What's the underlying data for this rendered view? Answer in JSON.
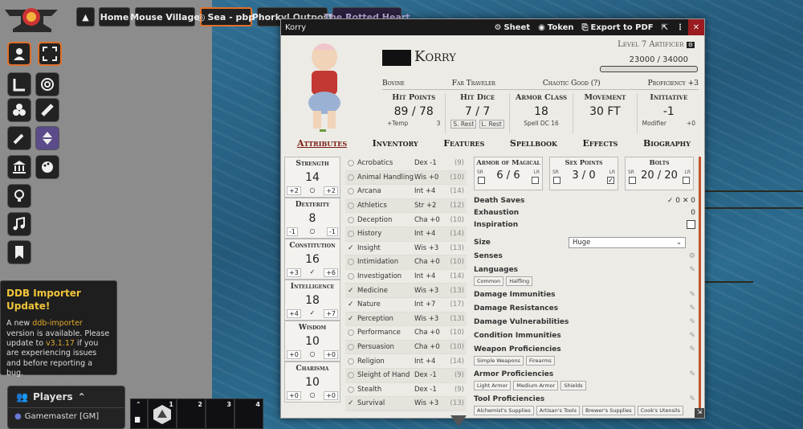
{
  "nav": {
    "home": "Home",
    "mouse_village": "Mouse Village",
    "sea": "Sea - pbp",
    "phorkyl": "Phorkyl Outpost",
    "rotted": "The Rotted Heart"
  },
  "ddb": {
    "title": "DDB Importer Update!",
    "line1": "A new ",
    "link": "ddb-importer",
    "line2": " version is available. Please update to ",
    "version": "v3.1.17",
    "line3": " if you are experiencing issues and before reporting a bug.",
    "close": "Click to close"
  },
  "players": {
    "title": "Players",
    "gm": "Gamemaster [GM]"
  },
  "hotbar": [
    "1",
    "2",
    "3",
    "4"
  ],
  "sheet": {
    "title": "Korry",
    "buttons": {
      "sheet": "Sheet",
      "token": "Token",
      "export": "Export to PDF"
    },
    "name": "Korry",
    "level": "Level 7 Artificer",
    "xp": "23000 / 34000",
    "info": [
      "Bovine",
      "Far Traveler",
      "Chaotic Good (?)",
      "Proficiency +3"
    ],
    "stats": [
      {
        "label": "Hit Points",
        "value": "89 / 78",
        "sub1": "+Temp",
        "sub2": "3"
      },
      {
        "label": "Hit Dice",
        "value": "7 / 7",
        "sub1": "S. Rest",
        "sub2": "L. Rest"
      },
      {
        "label": "Armor Class",
        "value": "18",
        "sub1": "Spell DC 16",
        "sub2": ""
      },
      {
        "label": "Movement",
        "value": "30 FT",
        "sub1": "",
        "sub2": ""
      },
      {
        "label": "Initiative",
        "value": "-1",
        "sub1": "Modifier",
        "sub2": "+0"
      }
    ],
    "tabs": [
      "Attributes",
      "Inventory",
      "Features",
      "Spellbook",
      "Effects",
      "Biography"
    ],
    "abilities": [
      {
        "name": "Strength",
        "score": "14",
        "mod": "+2",
        "save": "+2"
      },
      {
        "name": "Dexterity",
        "score": "8",
        "mod": "-1",
        "save": "-1"
      },
      {
        "name": "Constitution",
        "score": "16",
        "mod": "+3",
        "save": "+6"
      },
      {
        "name": "Intelligence",
        "score": "18",
        "mod": "+4",
        "save": "+7"
      },
      {
        "name": "Wisdom",
        "score": "10",
        "mod": "+0",
        "save": "+0"
      },
      {
        "name": "Charisma",
        "score": "10",
        "mod": "+0",
        "save": "+0"
      }
    ],
    "skills": [
      {
        "name": "Acrobatics",
        "ab": "Dex",
        "mod": "-1",
        "pas": "(9)",
        "prof": false
      },
      {
        "name": "Animal Handling",
        "ab": "Wis",
        "mod": "+0",
        "pas": "(10)",
        "prof": false
      },
      {
        "name": "Arcana",
        "ab": "Int",
        "mod": "+4",
        "pas": "(14)",
        "prof": false
      },
      {
        "name": "Athletics",
        "ab": "Str",
        "mod": "+2",
        "pas": "(12)",
        "prof": false
      },
      {
        "name": "Deception",
        "ab": "Cha",
        "mod": "+0",
        "pas": "(10)",
        "prof": false
      },
      {
        "name": "History",
        "ab": "Int",
        "mod": "+4",
        "pas": "(14)",
        "prof": false
      },
      {
        "name": "Insight",
        "ab": "Wis",
        "mod": "+3",
        "pas": "(13)",
        "prof": true
      },
      {
        "name": "Intimidation",
        "ab": "Cha",
        "mod": "+0",
        "pas": "(10)",
        "prof": false
      },
      {
        "name": "Investigation",
        "ab": "Int",
        "mod": "+4",
        "pas": "(14)",
        "prof": false
      },
      {
        "name": "Medicine",
        "ab": "Wis",
        "mod": "+3",
        "pas": "(13)",
        "prof": true
      },
      {
        "name": "Nature",
        "ab": "Int",
        "mod": "+7",
        "pas": "(17)",
        "prof": true
      },
      {
        "name": "Perception",
        "ab": "Wis",
        "mod": "+3",
        "pas": "(13)",
        "prof": true
      },
      {
        "name": "Performance",
        "ab": "Cha",
        "mod": "+0",
        "pas": "(10)",
        "prof": false
      },
      {
        "name": "Persuasion",
        "ab": "Cha",
        "mod": "+0",
        "pas": "(10)",
        "prof": false
      },
      {
        "name": "Religion",
        "ab": "Int",
        "mod": "+4",
        "pas": "(14)",
        "prof": false
      },
      {
        "name": "Sleight of Hand",
        "ab": "Dex",
        "mod": "-1",
        "pas": "(9)",
        "prof": false
      },
      {
        "name": "Stealth",
        "ab": "Dex",
        "mod": "-1",
        "pas": "(9)",
        "prof": false
      },
      {
        "name": "Survival",
        "ab": "Wis",
        "mod": "+3",
        "pas": "(13)",
        "prof": true
      }
    ],
    "resources": [
      {
        "name": "Armor of Magical",
        "cur": "6",
        "max": "6"
      },
      {
        "name": "Sex Points",
        "cur": "3",
        "max": "0"
      },
      {
        "name": "Bolts",
        "cur": "20",
        "max": "20"
      }
    ],
    "sr": "SR",
    "lr": "LR",
    "death": {
      "label": "Death Saves",
      "success": "0",
      "fail": "0"
    },
    "exhaustion": {
      "label": "Exhaustion",
      "value": "0"
    },
    "inspiration": "Inspiration",
    "size": {
      "label": "Size",
      "value": "Huge"
    },
    "senses": "Senses",
    "languages": {
      "label": "Languages",
      "items": [
        "Common",
        "Halfling"
      ]
    },
    "damage_immunities": "Damage Immunities",
    "damage_resistances": "Damage Resistances",
    "damage_vulnerabilities": "Damage Vulnerabilities",
    "condition_immunities": "Condition Immunities",
    "weapon": {
      "label": "Weapon Proficiencies",
      "items": [
        "Simple Weapons",
        "Firearms"
      ]
    },
    "armor": {
      "label": "Armor Proficiencies",
      "items": [
        "Light Armor",
        "Medium Armor",
        "Shields"
      ]
    },
    "tool": {
      "label": "Tool Proficiencies",
      "items": [
        "Alchemist's Supplies",
        "Artisan's Tools",
        "Brewer's Supplies",
        "Cook's Utensils"
      ]
    }
  }
}
